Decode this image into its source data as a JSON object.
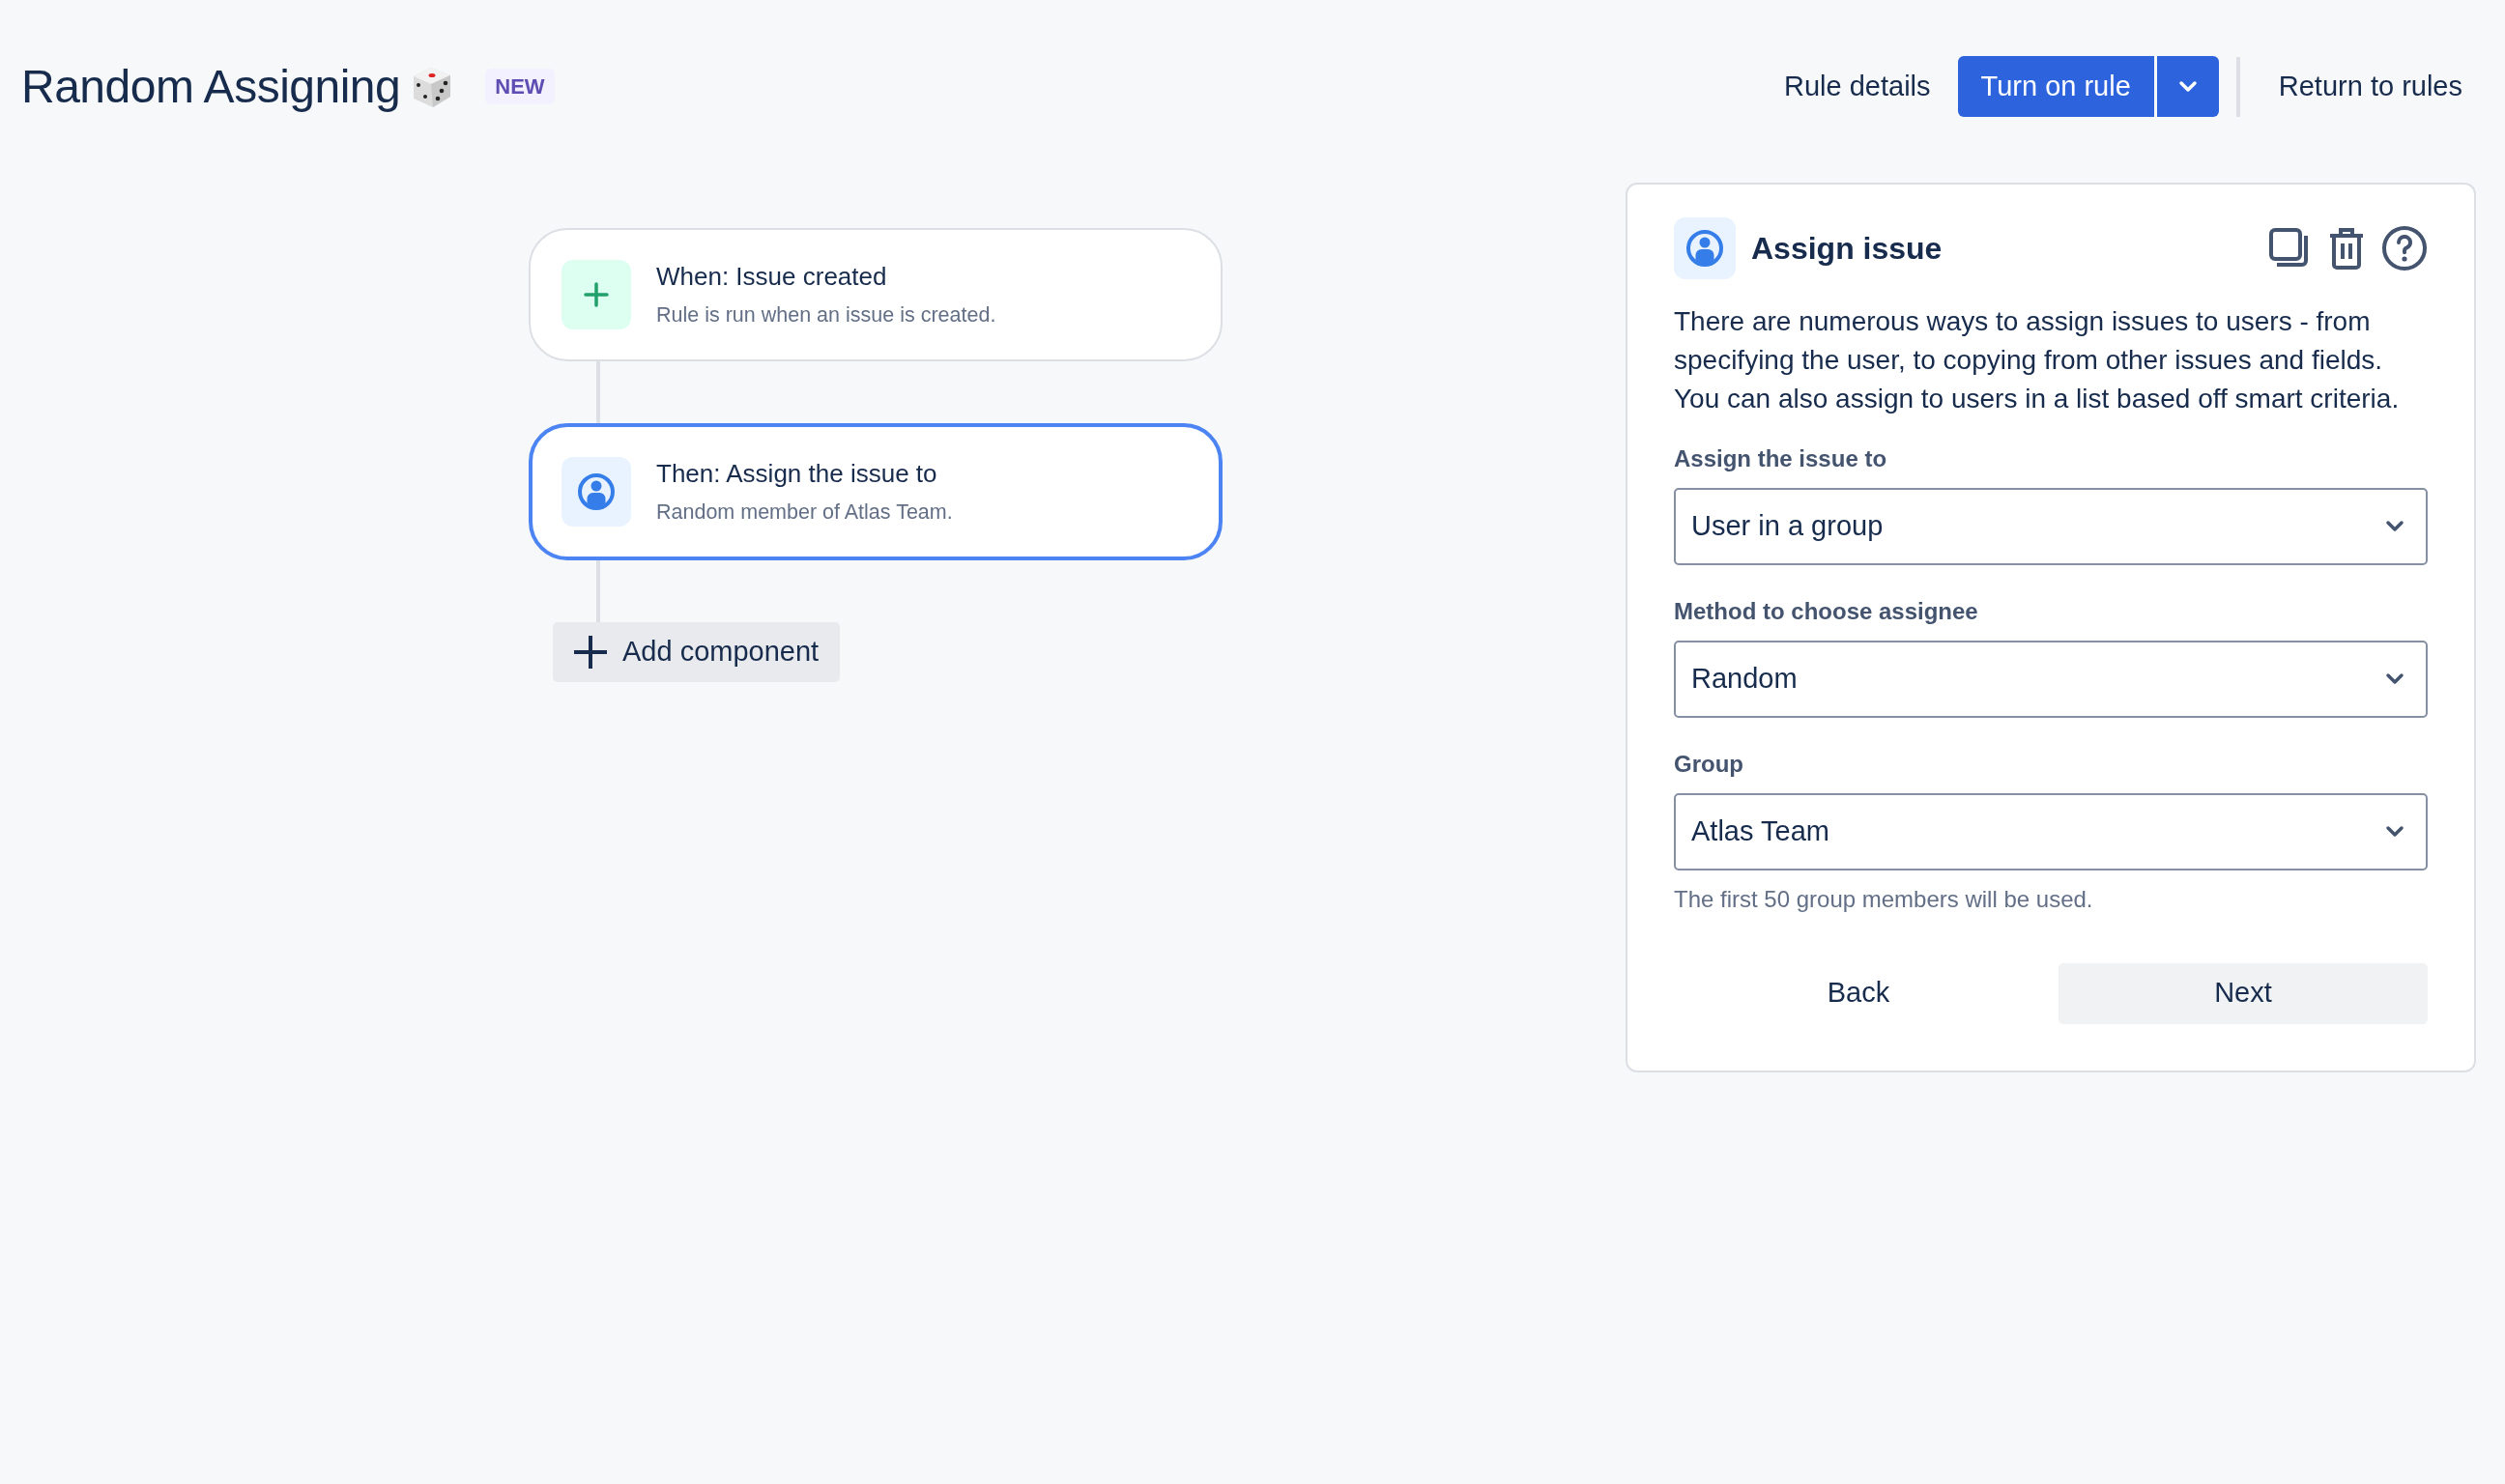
{
  "header": {
    "title": "Random Assigning",
    "badge": "NEW",
    "actions": [
      {
        "kind": "link",
        "label": "Rule details"
      },
      {
        "kind": "primary",
        "label": "Turn on rule"
      },
      {
        "kind": "link",
        "label": "Return to rules"
      }
    ]
  },
  "flow": {
    "nodes": [
      {
        "kind": "trigger",
        "title": "When: Issue created",
        "subtitle": "Rule is run when an issue is created.",
        "selected": false
      },
      {
        "kind": "action",
        "title": "Then: Assign the issue to",
        "subtitle": "Random member of Atlas Team.",
        "selected": true
      }
    ],
    "add_button": "Add component"
  },
  "panel": {
    "title": "Assign issue",
    "description": "There are numerous ways to assign issues to users - from specifying the user, to copying from other issues and fields. You can also assign to users in a list based off smart criteria.",
    "fields": [
      {
        "label": "Assign the issue to",
        "value": "User in a group"
      },
      {
        "label": "Method to choose assignee",
        "value": "Random"
      },
      {
        "label": "Group",
        "value": "Atlas Team",
        "helper": "The first 50 group members will be used."
      }
    ],
    "buttons": [
      {
        "kind": "subtle",
        "label": "Back"
      },
      {
        "kind": "default",
        "label": "Next"
      }
    ]
  }
}
